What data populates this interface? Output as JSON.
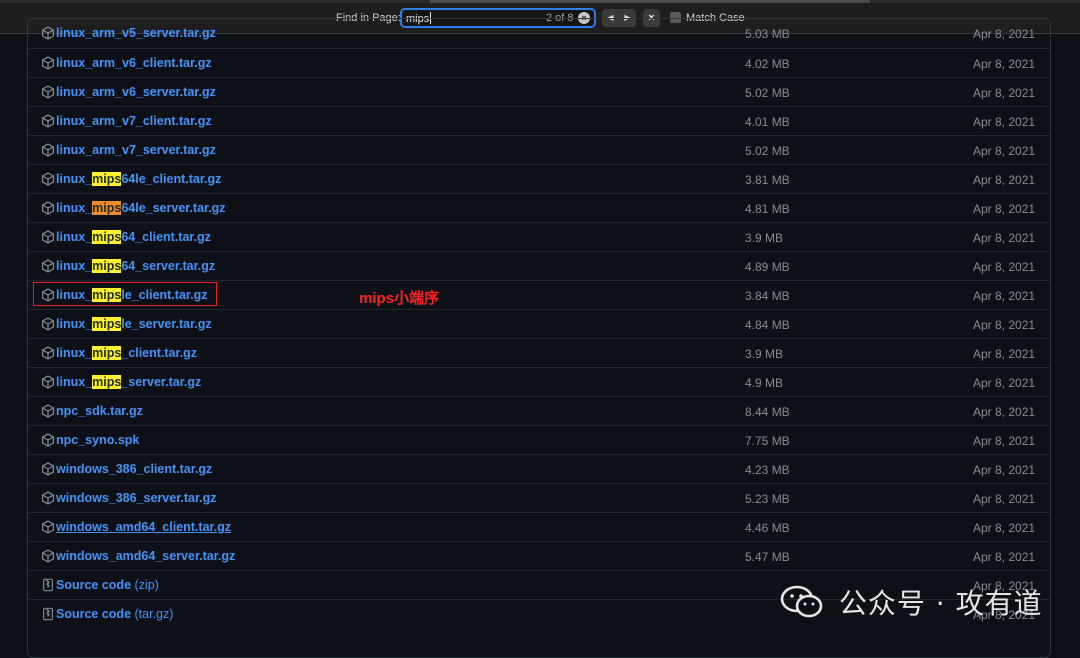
{
  "find_bar": {
    "label": "Find in Page:",
    "query": "mips",
    "match_count": "2 of 8",
    "match_case_label": "Match Case",
    "match_case_checked": false,
    "icons": {
      "clear": "clear-circle-icon",
      "prev": "triangle-left-icon",
      "next": "triangle-right-icon",
      "done": "x-icon"
    }
  },
  "assets": [
    {
      "name": "linux_arm_v5_server.tar.gz",
      "size": "5.03 MB",
      "date": "Apr 8, 2021"
    },
    {
      "name": "linux_arm_v6_client.tar.gz",
      "size": "4.02 MB",
      "date": "Apr 8, 2021"
    },
    {
      "name": "linux_arm_v6_server.tar.gz",
      "size": "5.02 MB",
      "date": "Apr 8, 2021"
    },
    {
      "name": "linux_arm_v7_client.tar.gz",
      "size": "4.01 MB",
      "date": "Apr 8, 2021"
    },
    {
      "name": "linux_arm_v7_server.tar.gz",
      "size": "5.02 MB",
      "date": "Apr 8, 2021"
    },
    {
      "name_pre": "linux_",
      "name_match": "mips",
      "name_post": "64le_client.tar.gz",
      "size": "3.81 MB",
      "date": "Apr 8, 2021"
    },
    {
      "name_pre": "linux_",
      "name_match": "mips",
      "name_post": "64le_server.tar.gz",
      "size": "4.81 MB",
      "date": "Apr 8, 2021"
    },
    {
      "name_pre": "linux_",
      "name_match": "mips",
      "name_post": "64_client.tar.gz",
      "size": "3.9 MB",
      "date": "Apr 8, 2021"
    },
    {
      "name_pre": "linux_",
      "name_match": "mips",
      "name_post": "64_server.tar.gz",
      "size": "4.89 MB",
      "date": "Apr 8, 2021"
    },
    {
      "name_pre": "linux_",
      "name_match": "mips",
      "name_post": "le_client.tar.gz",
      "size": "3.84 MB",
      "date": "Apr 8, 2021"
    },
    {
      "name_pre": "linux_",
      "name_match": "mips",
      "name_post": "le_server.tar.gz",
      "size": "4.84 MB",
      "date": "Apr 8, 2021"
    },
    {
      "name_pre": "linux_",
      "name_match": "mips",
      "name_post": "_client.tar.gz",
      "size": "3.9 MB",
      "date": "Apr 8, 2021"
    },
    {
      "name_pre": "linux_",
      "name_match": "mips",
      "name_post": "_server.tar.gz",
      "size": "4.9 MB",
      "date": "Apr 8, 2021"
    },
    {
      "name": "npc_sdk.tar.gz",
      "size": "8.44 MB",
      "date": "Apr 8, 2021"
    },
    {
      "name": "npc_syno.spk",
      "size": "7.75 MB",
      "date": "Apr 8, 2021"
    },
    {
      "name": "windows_386_client.tar.gz",
      "size": "4.23 MB",
      "date": "Apr 8, 2021"
    },
    {
      "name": "windows_386_server.tar.gz",
      "size": "5.23 MB",
      "date": "Apr 8, 2021"
    },
    {
      "name": "windows_amd64_client.tar.gz",
      "size": "4.46 MB",
      "date": "Apr 8, 2021"
    },
    {
      "name": "windows_amd64_server.tar.gz",
      "size": "5.47 MB",
      "date": "Apr 8, 2021"
    },
    {
      "name": "Source code",
      "suffix": "(zip)",
      "size": "",
      "date": "Apr 8, 2021"
    },
    {
      "name": "Source code",
      "suffix": "(tar.gz)",
      "size": "",
      "date": "Apr 8, 2021"
    }
  ],
  "annotation": {
    "text": "mips小端序",
    "color": "#e5212a"
  },
  "watermark": {
    "text": "公众号 · 攻有道",
    "icon": "wechat-icon"
  },
  "colors": {
    "link": "#4493f8",
    "muted": "#848d97",
    "highlight": "#fff12e",
    "current_highlight": "#f08b2d",
    "find_focus": "#2f7fe8"
  }
}
